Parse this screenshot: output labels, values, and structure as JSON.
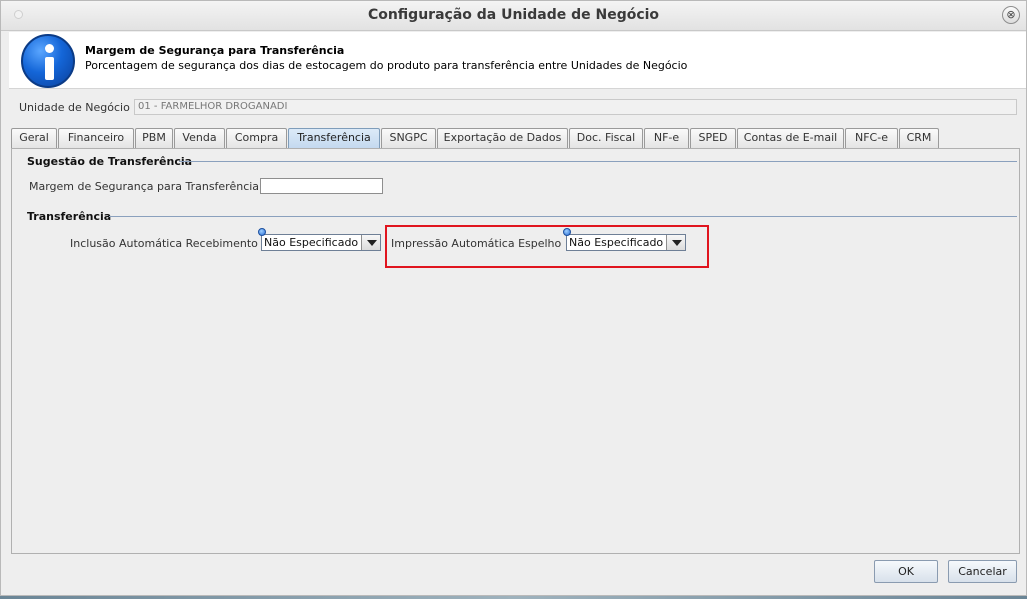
{
  "window": {
    "title": "Configuração da Unidade de Negócio",
    "close_glyph": "⊗"
  },
  "banner": {
    "icon": "info-icon",
    "title": "Margem de Segurança para Transferência",
    "description": "Porcentagem de segurança dos dias de estocagem do produto para transferência entre Unidades de Negócio"
  },
  "business_unit": {
    "label": "Unidade de Negócio",
    "value": "01 - FARMELHOR DROGANADI"
  },
  "tabs": [
    {
      "label": "Geral"
    },
    {
      "label": "Financeiro"
    },
    {
      "label": "PBM"
    },
    {
      "label": "Venda"
    },
    {
      "label": "Compra"
    },
    {
      "label": "Transferência"
    },
    {
      "label": "SNGPC"
    },
    {
      "label": "Exportação de Dados"
    },
    {
      "label": "Doc. Fiscal"
    },
    {
      "label": "NF-e"
    },
    {
      "label": "SPED"
    },
    {
      "label": "Contas de E-mail"
    },
    {
      "label": "NFC-e"
    },
    {
      "label": "CRM"
    }
  ],
  "active_tab": "Transferência",
  "sections": {
    "suggestion": {
      "title": "Sugestão de Transferência",
      "margin_label": "Margem de Segurança para Transferência",
      "margin_value": ""
    },
    "transfer": {
      "title": "Transferência",
      "auto_receipt_label": "Inclusão Automática Recebimento",
      "auto_receipt_value": "Não Especificado",
      "auto_print_label": "Impressão Automática Espelho",
      "auto_print_value": "Não Especificado"
    }
  },
  "buttons": {
    "ok": "OK",
    "cancel": "Cancelar"
  },
  "colors": {
    "highlight": "#e0141e",
    "active_tab": "#c4d9ef",
    "section_line": "#8aa0bd"
  }
}
